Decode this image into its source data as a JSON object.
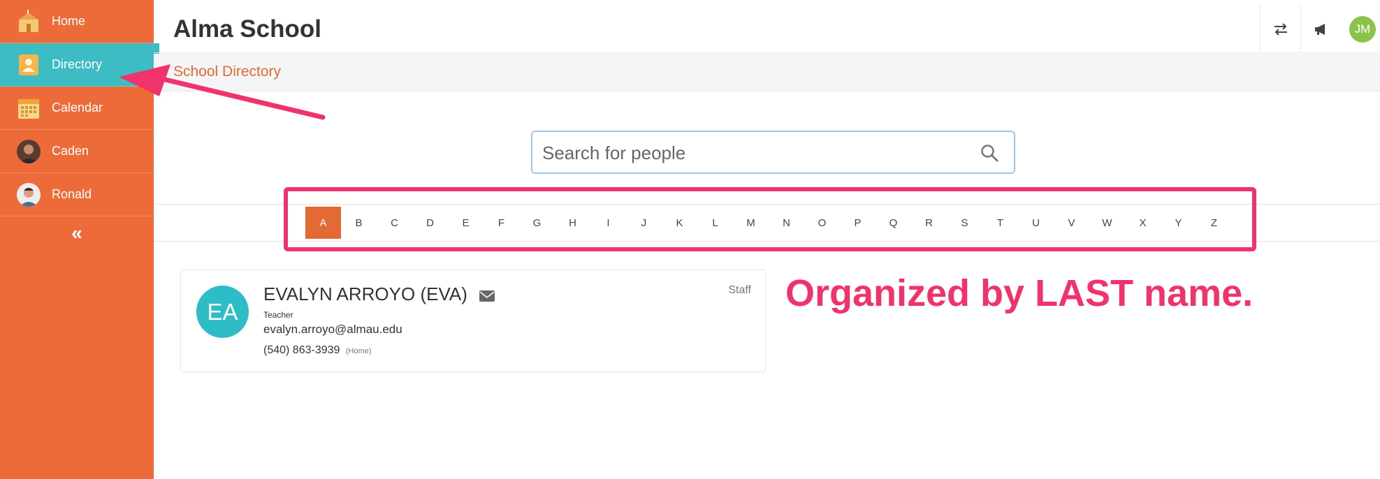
{
  "colors": {
    "sidebar": "#ec6b39",
    "sidebar_active": "#3dbdc3",
    "accent": "#e46a34",
    "annotation": "#f0346b",
    "user_avatar": "#8bc34a",
    "person_avatar": "#2ebcc7"
  },
  "sidebar": {
    "items": [
      {
        "label": "Home",
        "icon": "school-building-icon"
      },
      {
        "label": "Directory",
        "icon": "directory-person-icon",
        "active": true
      },
      {
        "label": "Calendar",
        "icon": "calendar-icon"
      },
      {
        "label": "Caden",
        "icon": "student-avatar"
      },
      {
        "label": "Ronald",
        "icon": "student-avatar"
      }
    ],
    "collapse_label": "«"
  },
  "header": {
    "title": "Alma School",
    "icons": [
      "switch-arrows-icon",
      "megaphone-icon"
    ],
    "user_initials": "JM"
  },
  "breadcrumb": {
    "label": "School Directory"
  },
  "search": {
    "placeholder": "Search for people",
    "value": ""
  },
  "alphabet": {
    "letters": [
      "A",
      "B",
      "C",
      "D",
      "E",
      "F",
      "G",
      "H",
      "I",
      "J",
      "K",
      "L",
      "M",
      "N",
      "O",
      "P",
      "Q",
      "R",
      "S",
      "T",
      "U",
      "V",
      "W",
      "X",
      "Y",
      "Z"
    ],
    "selected": "A"
  },
  "person": {
    "initials": "EA",
    "name": "EVALYN ARROYO (EVA)",
    "role": "Teacher",
    "email": "evalyn.arroyo@almau.edu",
    "phone": "(540) 863-3939",
    "phone_type": "(Home)",
    "type": "Staff"
  },
  "annotation": {
    "text": "Organized by LAST name."
  }
}
